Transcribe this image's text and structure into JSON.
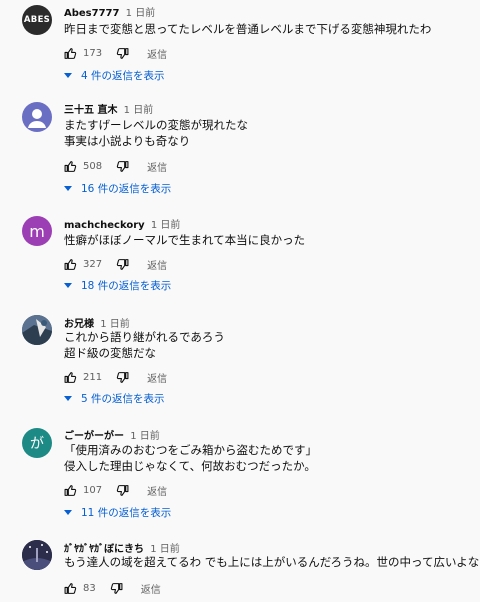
{
  "ui": {
    "reply_label": "返信",
    "accent_color": "#065fd4"
  },
  "comments": [
    {
      "author": "Abes7777",
      "time": "1 日前",
      "avatar_text": "ABES",
      "lines": [
        "昨日まで変態と思ってたレベルを普通レベルまで下げる変態神現れたわ"
      ],
      "likes": "173",
      "replies": "4 件の返信を表示"
    },
    {
      "author": "三十五 直木",
      "time": "1 日前",
      "avatar_text": "",
      "lines": [
        "またすげーレベルの変態が現れたな",
        "事実は小説よりも奇なり"
      ],
      "likes": "508",
      "replies": "16 件の返信を表示"
    },
    {
      "author": "machcheckory",
      "time": "1 日前",
      "avatar_text": "m",
      "lines": [
        "性癖がほぼノーマルで生まれて本当に良かった"
      ],
      "likes": "327",
      "replies": "18 件の返信を表示"
    },
    {
      "author": "お兄様",
      "time": "1 日前",
      "avatar_text": "",
      "lines": [
        "これから語り継がれるであろう",
        "超ド級の変態だな"
      ],
      "likes": "211",
      "replies": "5 件の返信を表示"
    },
    {
      "author": "ごーがーがー",
      "time": "1 日前",
      "avatar_text": "が",
      "lines": [
        "「使用済みのおむつをごみ箱から盗むためです」",
        "侵入した理由じゃなくて、何故おむつだったか。"
      ],
      "likes": "107",
      "replies": "11 件の返信を表示"
    },
    {
      "author": "ｶﾞﾔｶﾞﾔｶﾞぼにきち",
      "time": "1 日前",
      "avatar_text": "",
      "lines": [
        "もう達人の域を超えてるわ でも上には上がいるんだろうね。世の中って広いよなー"
      ],
      "likes": "83",
      "replies": ""
    }
  ]
}
